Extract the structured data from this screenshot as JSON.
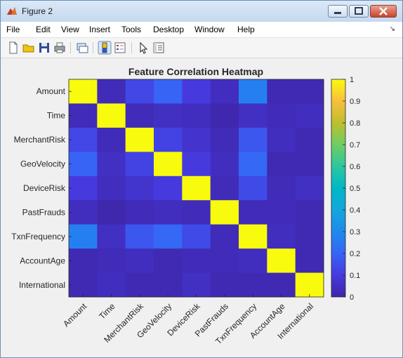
{
  "window": {
    "title": "Figure 2"
  },
  "menu": {
    "items": [
      "File",
      "Edit",
      "View",
      "Insert",
      "Tools",
      "Desktop",
      "Window",
      "Help"
    ]
  },
  "toolbar": {
    "icons": [
      "new-figure-icon",
      "open-file-icon",
      "save-icon",
      "print-icon",
      "link-plot-icon",
      "insert-colorbar-icon",
      "insert-legend-icon",
      "pointer-icon",
      "property-editor-icon"
    ]
  },
  "colors": {
    "low": "#3e26a8",
    "high": "#f9fb0e",
    "colormap": "parula"
  },
  "chart_data": {
    "type": "heatmap",
    "title": "Feature Correlation Heatmap",
    "x_labels": [
      "Amount",
      "Time",
      "MerchantRisk",
      "GeoVelocity",
      "DeviceRisk",
      "PastFrauds",
      "TxnFrequency",
      "AccountAge",
      "International"
    ],
    "y_labels": [
      "Amount",
      "Time",
      "MerchantRisk",
      "GeoVelocity",
      "DeviceRisk",
      "PastFrauds",
      "TxnFrequency",
      "AccountAge",
      "International"
    ],
    "values": [
      [
        1.0,
        0.03,
        0.13,
        0.2,
        0.1,
        0.04,
        0.27,
        0.02,
        0.02
      ],
      [
        0.03,
        1.0,
        0.03,
        0.05,
        0.04,
        0.01,
        0.05,
        0.03,
        0.04
      ],
      [
        0.13,
        0.03,
        1.0,
        0.12,
        0.07,
        0.03,
        0.17,
        0.04,
        0.02
      ],
      [
        0.2,
        0.05,
        0.12,
        1.0,
        0.1,
        0.04,
        0.21,
        0.02,
        0.02
      ],
      [
        0.1,
        0.04,
        0.07,
        0.1,
        1.0,
        0.03,
        0.14,
        0.03,
        0.05
      ],
      [
        0.04,
        0.01,
        0.03,
        0.04,
        0.03,
        1.0,
        0.03,
        0.03,
        0.02
      ],
      [
        0.27,
        0.05,
        0.17,
        0.21,
        0.14,
        0.03,
        1.0,
        0.04,
        0.02
      ],
      [
        0.02,
        0.03,
        0.04,
        0.02,
        0.03,
        0.03,
        0.04,
        1.0,
        0.02
      ],
      [
        0.02,
        0.04,
        0.02,
        0.02,
        0.05,
        0.02,
        0.02,
        0.02,
        1.0
      ]
    ],
    "colorbar": {
      "ticks": [
        "0",
        "0.1",
        "0.2",
        "0.3",
        "0.4",
        "0.5",
        "0.6",
        "0.7",
        "0.8",
        "0.9",
        "1"
      ],
      "range": [
        0,
        1
      ]
    },
    "grid": false
  }
}
